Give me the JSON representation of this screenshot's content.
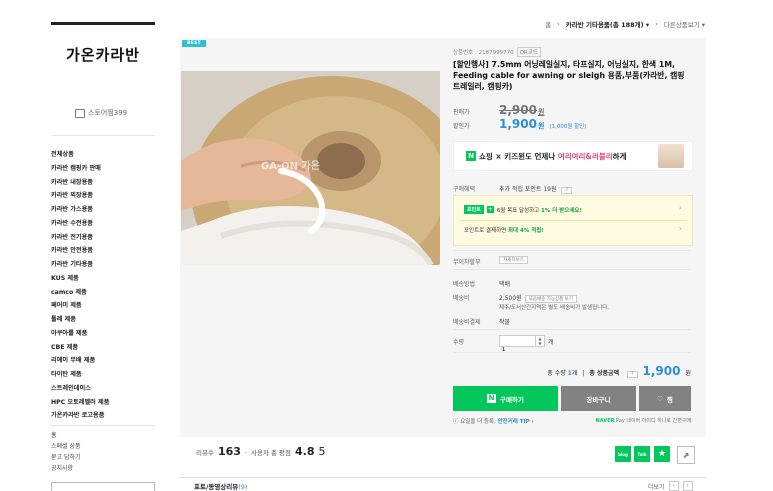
{
  "sidebar": {
    "logo": "가온카라반",
    "store_button": "스토어찜399",
    "categories": [
      "전체상품",
      "카라반 캠핑카 판매",
      "카라반 내장용품",
      "카라반 외장용품",
      "카라반 가스용품",
      "카라반 수전용품",
      "카라반 전기용품",
      "카라반 안전용품",
      "카라반 기타용품",
      "KUS 제품",
      "camco 제품",
      "페어미 제품",
      "툴레 제품",
      "아쿠아롤 제품",
      "CBE 제품",
      "리에이 무배 제품",
      "타이탄 제품",
      "스트레인데이스",
      "HPC 오토레벨러 제품",
      "가온카라반 로고용품"
    ],
    "links": [
      "홈",
      "스페셜 상품",
      "묻고 답하기",
      "공지사항"
    ]
  },
  "breadcrumb": {
    "home": "홈",
    "sep": "›",
    "current": "카라반 기타용품(총 188개)",
    "chevron": "▾",
    "other": "다른상품보기 ▾"
  },
  "badge": "BEST",
  "product": {
    "code_label": "상품번호 : 2187999770",
    "cert_label": "QR코드",
    "title": "[할인행사] 7.5mm 어닝레일실지, 타프실지, 어닝실지, 한색 1M, Feeding cable for awning or sleigh 용품,부품(카라반, 캠핑트레일러, 캠핑카)",
    "price_label": "판매가",
    "original_price": "2,900",
    "discount_label": "할인가",
    "sale_price": "1,900",
    "won": "원",
    "discount_note": "(1,000원 할인)"
  },
  "banner": {
    "n": "N",
    "text_a": "쇼핑 × 키즈윈도  언제나 ",
    "text_b": "여리여리&러블리",
    "text_c": "하게"
  },
  "benefits": {
    "label": "구매혜택",
    "value": "추가 적립 포인트 19원",
    "help": "?",
    "pill": "포인트",
    "plus": "+",
    "line1_a": "6월 목표 달성하고 ",
    "line1_b": "1% 더 받으세요!",
    "line2_a": "포인트로 결제하면 ",
    "line2_b": "최대 4% 적립!",
    "chevron": "›"
  },
  "installment": {
    "label": "무이자할부",
    "button": "자세히보기"
  },
  "shipping": {
    "method_label": "배송방법",
    "method": "택배",
    "fee_label": "배송비",
    "fee": "2,500원",
    "fee_button": "묶음배송 가능상품 보기",
    "island_note": "제주/도서산간지역은 별도 배송비가 발생됩니다.",
    "pay_label": "배송비결제",
    "pay": "착불"
  },
  "quantity": {
    "label": "수량",
    "value": "1",
    "up": "▲",
    "down": "▼",
    "unit": "개"
  },
  "total": {
    "qty_text": "총 수량 ",
    "qty": "1",
    "qty_unit": "개",
    "sep": "|",
    "amount_label": "총 상품금액",
    "help": "?",
    "amount": "1,900",
    "won": "원"
  },
  "buttons": {
    "buy_n": "N",
    "buy": "구매하기",
    "cart": "장바구니",
    "wish": "찜"
  },
  "talk": {
    "a": "ⓘ 요일을 더 등록, ",
    "b": "안전거래 TIP ›"
  },
  "npay": {
    "a": "NAVER",
    "b": " Pay 네이버 아이디 하나로 간편구매"
  },
  "review": {
    "count_label": "리뷰수",
    "count": "163",
    "sep": "·",
    "score_label": "사용자 총 평점",
    "score": "4.8",
    "score_max": "5"
  },
  "share": {
    "blog": "blog",
    "talk": "Talk",
    "star": "★",
    "arrow": "⇗"
  },
  "tab": {
    "label": "포토/동영상리뷰",
    "count": "(9)"
  },
  "more": {
    "label": "더보기",
    "prev": "‹",
    "next": "›"
  },
  "colors": {
    "naver_green": "#03c75a",
    "price_blue": "#2a8fd6",
    "best_badge": "#2ec0d3"
  }
}
